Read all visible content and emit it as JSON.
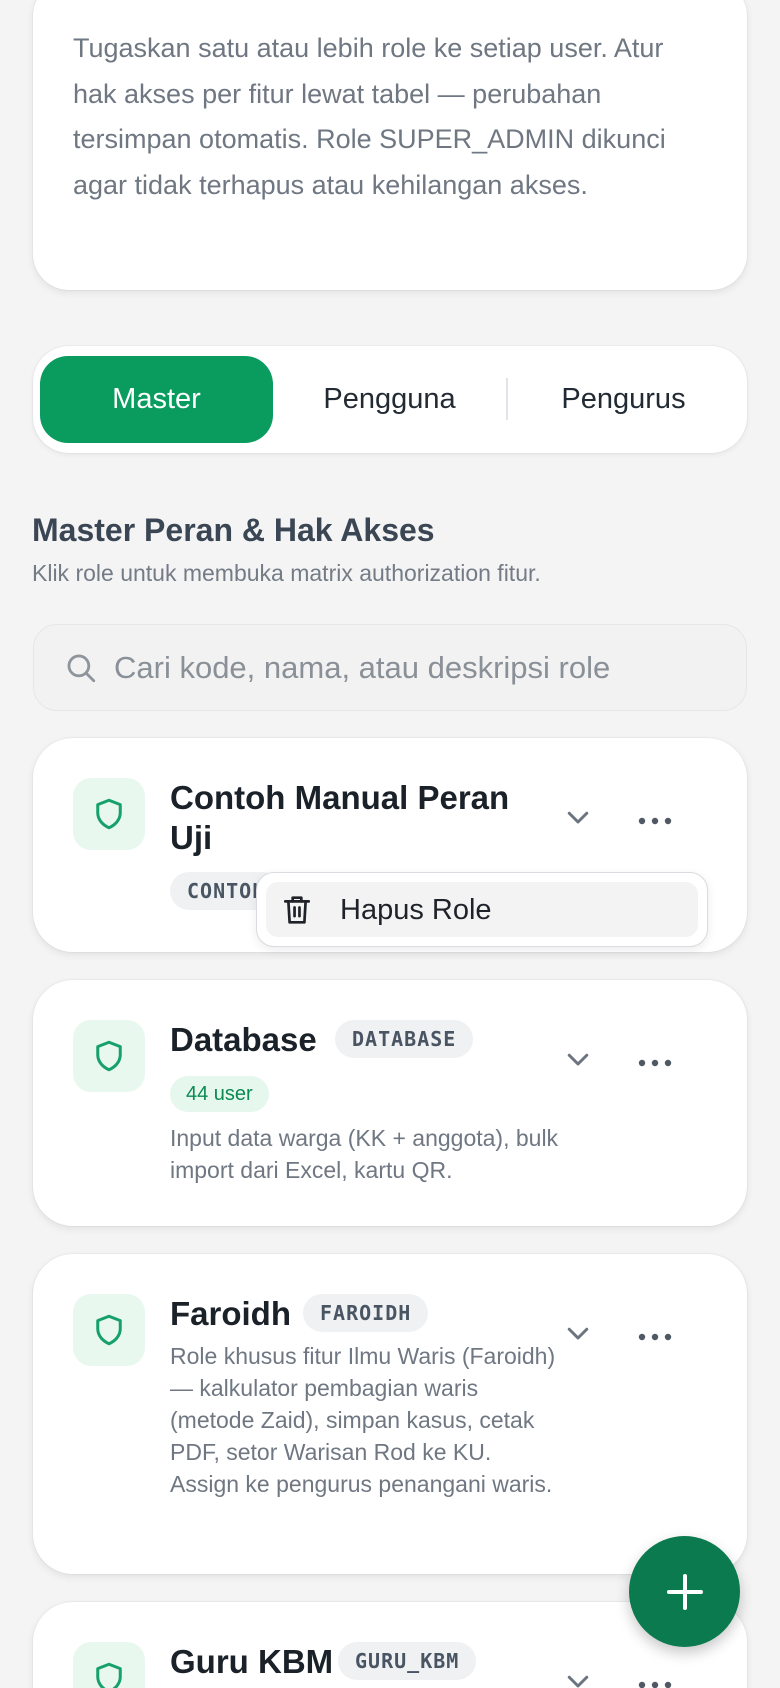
{
  "info": {
    "text": "Tugaskan satu atau lebih role ke setiap user. Atur hak akses per fitur lewat tabel — perubahan tersimpan otomatis. Role SUPER_ADMIN dikunci agar tidak terhapus atau kehilangan akses."
  },
  "tabs": [
    {
      "label": "Master",
      "active": true
    },
    {
      "label": "Pengguna",
      "active": false
    },
    {
      "label": "Pengurus",
      "active": false
    }
  ],
  "section": {
    "title": "Master Peran & Hak Akses",
    "subtitle": "Klik role untuk membuka matrix authorization fitur."
  },
  "search": {
    "placeholder": "Cari kode, nama, atau deskripsi role",
    "value": ""
  },
  "roles": [
    {
      "name": "Contoh Manual Peran Uji",
      "code": "CONTOH",
      "users": "",
      "description": ""
    },
    {
      "name": "Database",
      "code": "DATABASE",
      "users": "44 user",
      "description": "Input data warga (KK + anggota), bulk import dari Excel, kartu QR."
    },
    {
      "name": "Faroidh",
      "code": "FAROIDH",
      "users": "",
      "description": "Role khusus fitur Ilmu Waris (Faroidh) — kalkulator pembagian waris (metode Zaid), simpan kasus, cetak PDF, setor Warisan Rod ke KU. Assign ke pengurus penangani waris."
    },
    {
      "name": "Guru KBM",
      "code": "GURU_KBM",
      "users": "",
      "description": ""
    }
  ],
  "popup": {
    "label": "Hapus Role",
    "icon": "trash-icon"
  },
  "icons": {
    "role": "shield-icon",
    "expand": "chevron-down-icon",
    "menu": "more-horizontal-icon",
    "search": "search-icon",
    "add": "plus-icon"
  },
  "colors": {
    "primary": "#0a9c5f",
    "fab": "#0b7a4f",
    "shield_bg": "#e8f8ef",
    "shield": "#16a06a"
  }
}
